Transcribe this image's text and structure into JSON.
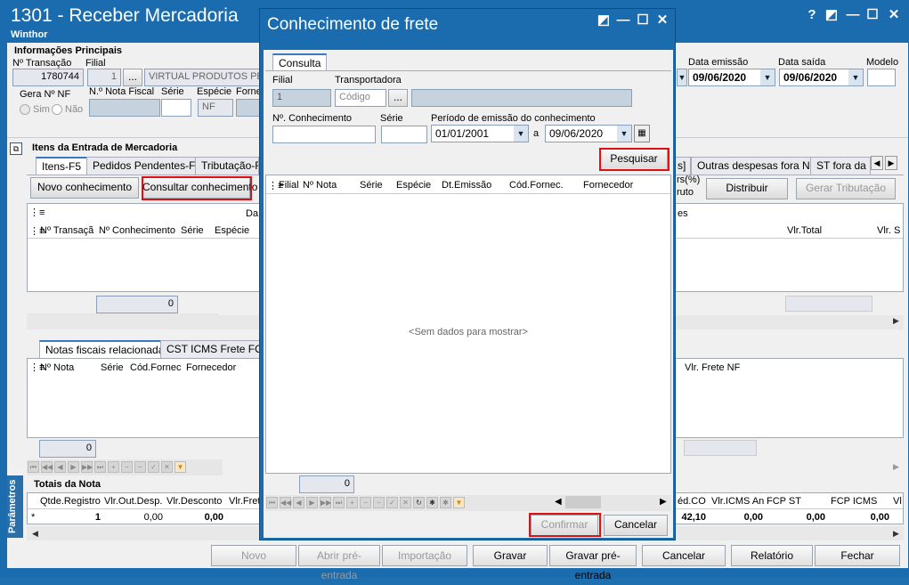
{
  "window": {
    "title": "1301 - Receber Mercadoria",
    "subtitle": "Winthor",
    "controls": [
      "?",
      "◩",
      "—",
      "☐",
      "✕"
    ]
  },
  "main": {
    "group_title": "Informações Principais",
    "nr_transacao_label": "Nº Transação",
    "nr_transacao_value": "1780744",
    "filial_label": "Filial",
    "filial_value": "1",
    "filial_btn": "...",
    "filial_name": "VIRTUAL PRODUTOS PESS",
    "gera_nf_label": "Gera Nº NF",
    "sim_label": "Sim",
    "nao_label": "Não",
    "nota_fiscal_label": "N.º Nota Fiscal",
    "serie_label": "Série",
    "especie_label": "Espécie",
    "especie_value": "NF",
    "fornecedor_label": "Forne",
    "data_emissao_label": "Data emissão",
    "data_emissao_value": "09/06/2020",
    "data_saida_label": "Data saída",
    "data_saida_value": "09/06/2020",
    "modelo_label": "Modelo"
  },
  "itens": {
    "title": "Itens da Entrada de Mercadoria",
    "tabs": [
      "Itens-F5",
      "Pedidos Pendentes-F6",
      "Tributação-F6"
    ],
    "right_tabs": [
      "s]",
      "Outras despesas fora NF",
      "ST fora da N"
    ],
    "btn_novo": "Novo conhecimento",
    "btn_consultar": "Consultar conhecimento",
    "frag_rs": "rs(%)",
    "frag_bruto": "ruto",
    "btn_distribuir": "Distribuir",
    "btn_gerar": "Gerar Tributação",
    "grid_header_group": "Da",
    "grid_header_group_right": "es",
    "columns": [
      "Nº Transaçã",
      "Nº Conhecimento",
      "Série",
      "Espécie"
    ],
    "right_columns": [
      "Vlr.Total",
      "Vlr. S"
    ],
    "count": "0"
  },
  "notas": {
    "tabs": [
      "Notas fiscais relacionadas",
      "CST ICMS Frete FOB"
    ],
    "columns": [
      "Nº Nota",
      "Série",
      "Cód.Fornec",
      "Fornecedor"
    ],
    "right_column": "Vlr. Frete NF",
    "count": "0"
  },
  "totais": {
    "title": "Totais da Nota",
    "columns": [
      "Qtde.Registro",
      "Vlr.Out.Desp.",
      "Vlr.Desconto",
      "Vlr.Fret"
    ],
    "row_marker": "*",
    "values": [
      "1",
      "0,00",
      "0,00"
    ],
    "right_columns": [
      "éd.CO",
      "Vlr.ICMS An",
      "FCP ST",
      "FCP ICMS",
      "Vl"
    ],
    "right_values": [
      "42,10",
      "0,00",
      "0,00",
      "0,00"
    ]
  },
  "side_label": "Parâmetros",
  "bottom_buttons": [
    "Novo",
    "Abrir pré-entrada",
    "Importação",
    "Gravar",
    "Gravar pré-entrada",
    "Cancelar",
    "Relatório",
    "Fechar"
  ],
  "dialog": {
    "title": "Conhecimento de frete",
    "controls": [
      "◩",
      "—",
      "☐",
      "✕"
    ],
    "tab": "Consulta",
    "filial_label": "Filial",
    "filial_value": "1",
    "transportadora_label": "Transportadora",
    "transportadora_placeholder": "Código",
    "transportadora_btn": "...",
    "conhecimento_label": "Nº. Conhecimento",
    "serie_label": "Série",
    "periodo_label": "Período de emissão do conhecimento",
    "data_inicio": "01/01/2001",
    "a_label": "a",
    "data_fim": "09/06/2020",
    "pesquisar_btn": "Pesquisar",
    "columns": [
      "Filial",
      "Nº Nota",
      "Série",
      "Espécie",
      "Dt.Emissão",
      "Cód.Fornec.",
      "Fornecedor"
    ],
    "empty_text": "<Sem dados para mostrar>",
    "count": "0",
    "confirmar_btn": "Confirmar",
    "cancelar_btn": "Cancelar"
  }
}
